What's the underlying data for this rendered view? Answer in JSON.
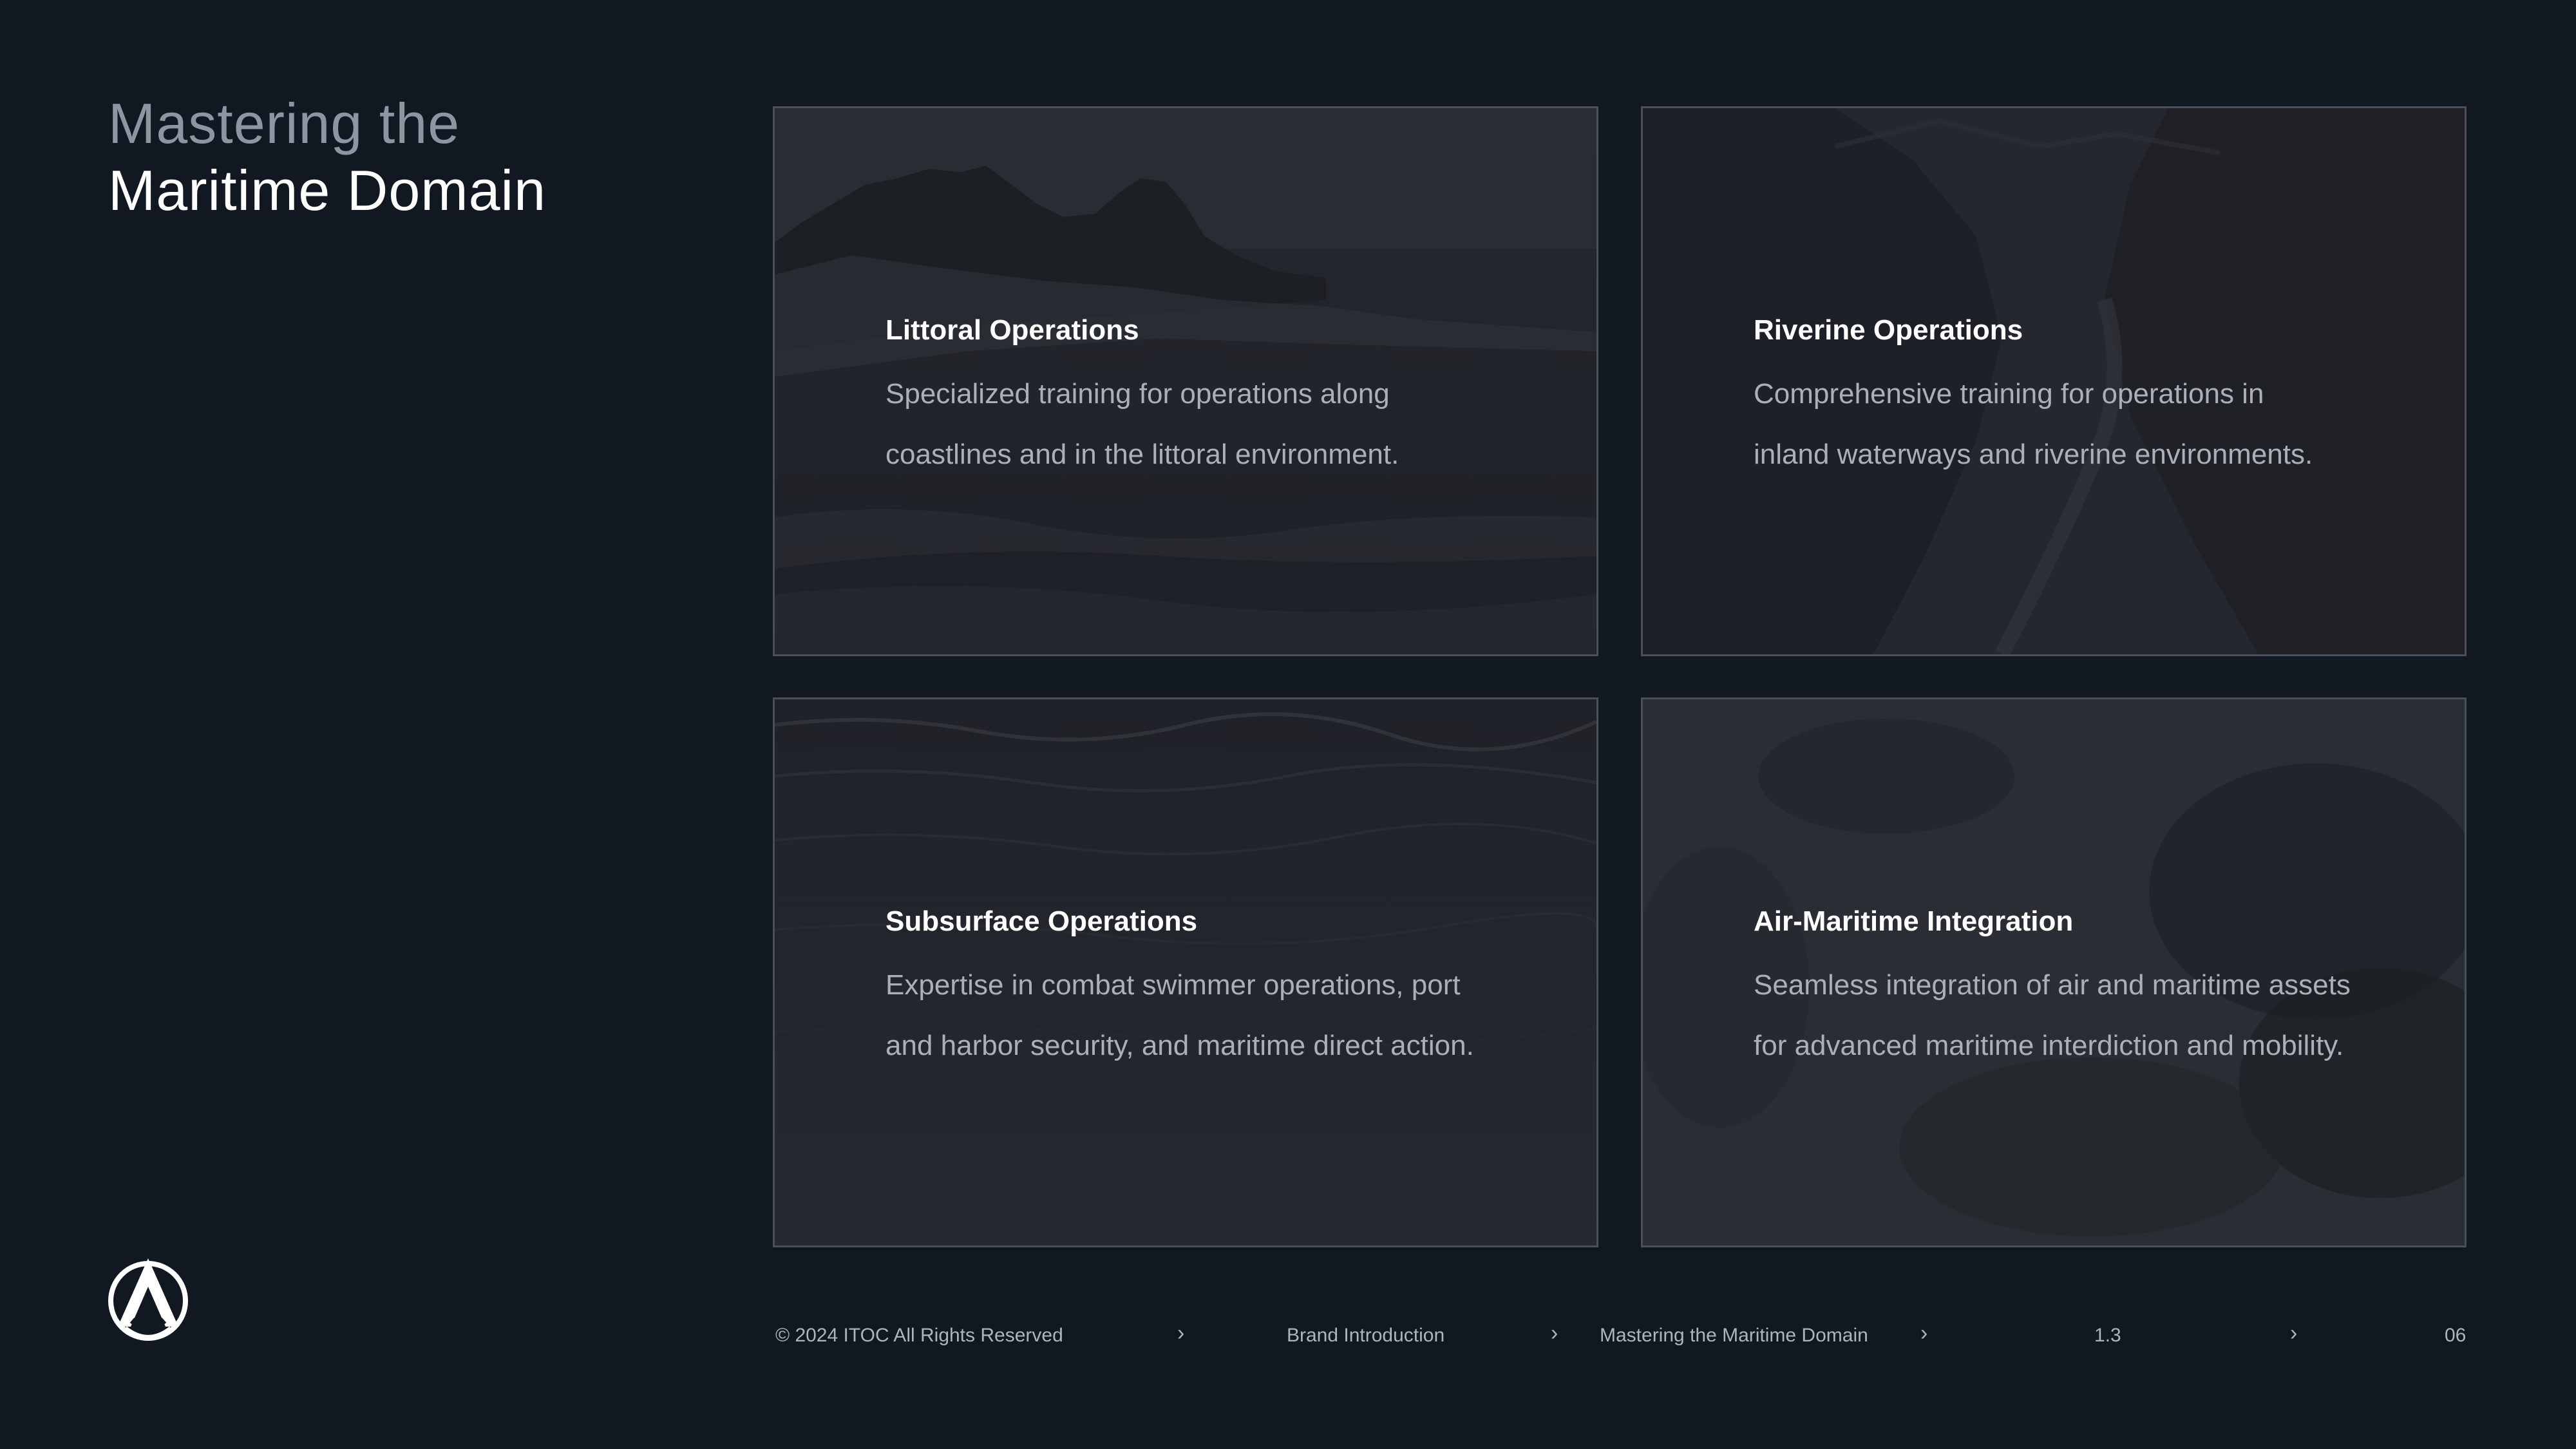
{
  "title": {
    "line1": "Mastering the",
    "line2": "Maritime Domain"
  },
  "cards": [
    {
      "title": "Littoral Operations",
      "desc_line1": "Specialized training for operations along",
      "desc_line2": "coastlines and in the littoral environment.",
      "image": "coastal-cliffs-photo"
    },
    {
      "title": "Riverine Operations",
      "desc_line1": "Comprehensive training for operations in",
      "desc_line2": "inland waterways and riverine environments.",
      "image": "river-canyon-photo"
    },
    {
      "title": "Subsurface Operations",
      "desc_line1": "Expertise in combat swimmer operations, port",
      "desc_line2": "and harbor security, and maritime direct action.",
      "image": "ocean-surface-photo"
    },
    {
      "title": "Air-Maritime Integration",
      "desc_line1": "Seamless integration of air and maritime assets",
      "desc_line2": "for advanced maritime interdiction and mobility.",
      "image": "clouds-photo"
    }
  ],
  "footer": {
    "copyright": "© 2024 ITOC All Rights Reserved",
    "section": "Brand Introduction",
    "subsection": "Mastering the Maritime Domain",
    "number": "1.3",
    "page": "06",
    "separator": "›"
  },
  "logo": "itoc-logo-icon"
}
